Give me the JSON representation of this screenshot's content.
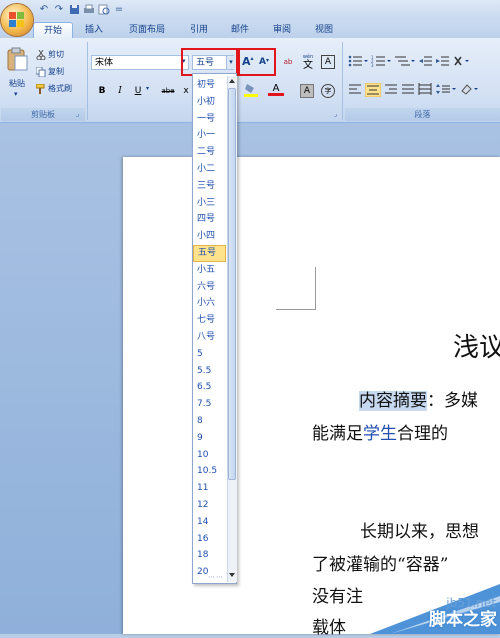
{
  "quick_access": {
    "icons": [
      "undo-icon",
      "redo-icon",
      "save-icon",
      "print-icon",
      "preview-icon",
      "customize-icon"
    ],
    "undo": "↶",
    "redo": "↷",
    "customize": "="
  },
  "tabs": [
    {
      "label": "开始",
      "active": true
    },
    {
      "label": "插入"
    },
    {
      "label": "页面布局"
    },
    {
      "label": "引用"
    },
    {
      "label": "邮件"
    },
    {
      "label": "审阅"
    },
    {
      "label": "视图"
    }
  ],
  "clipboard": {
    "paste_label": "粘贴",
    "cut_label": "剪切",
    "copy_label": "复制",
    "format_painter_label": "格式刷",
    "group_label": "剪贴板"
  },
  "font": {
    "font_name": "宋体",
    "font_size": "五号",
    "grow_label": "A",
    "shrink_label": "A",
    "clear_label": "ab",
    "phonetic_label": "wén",
    "phonetic_char": "文",
    "border_label": "A"
  },
  "format_buttons": {
    "bold": "B",
    "italic": "I",
    "underline": "U",
    "strike": "abe",
    "sub": "x"
  },
  "paragraph": {
    "group_label": "段落"
  },
  "size_options": [
    "初号",
    "小初",
    "一号",
    "小一",
    "二号",
    "小二",
    "三号",
    "小三",
    "四号",
    "小四",
    "五号",
    "小五",
    "六号",
    "小六",
    "七号",
    "八号",
    "5",
    "5.5",
    "6.5",
    "7.5",
    "8",
    "9",
    "10",
    "10.5",
    "11",
    "12",
    "14",
    "16",
    "18",
    "20"
  ],
  "selected_size": "五号",
  "document": {
    "title_part": "浅议",
    "abstract_label": "内容摘要",
    "abstract_line1_rest": "：多媒",
    "line2_part1": "能满足",
    "line2_highlight": "学生",
    "line2_part2": "合理的",
    "para_line1": "长期以来，思想",
    "para_line2": "了被灌输的“容器”",
    "para_line3": "没有注",
    "para_line4": "载体"
  },
  "watermark": {
    "site": "jb51.net",
    "name": "脚本之家"
  },
  "colors": {
    "accent": "#15428b",
    "highlight": "#c6d9f1",
    "selected_size_bg": "#ffe28c",
    "red_box": "#e3141c"
  }
}
